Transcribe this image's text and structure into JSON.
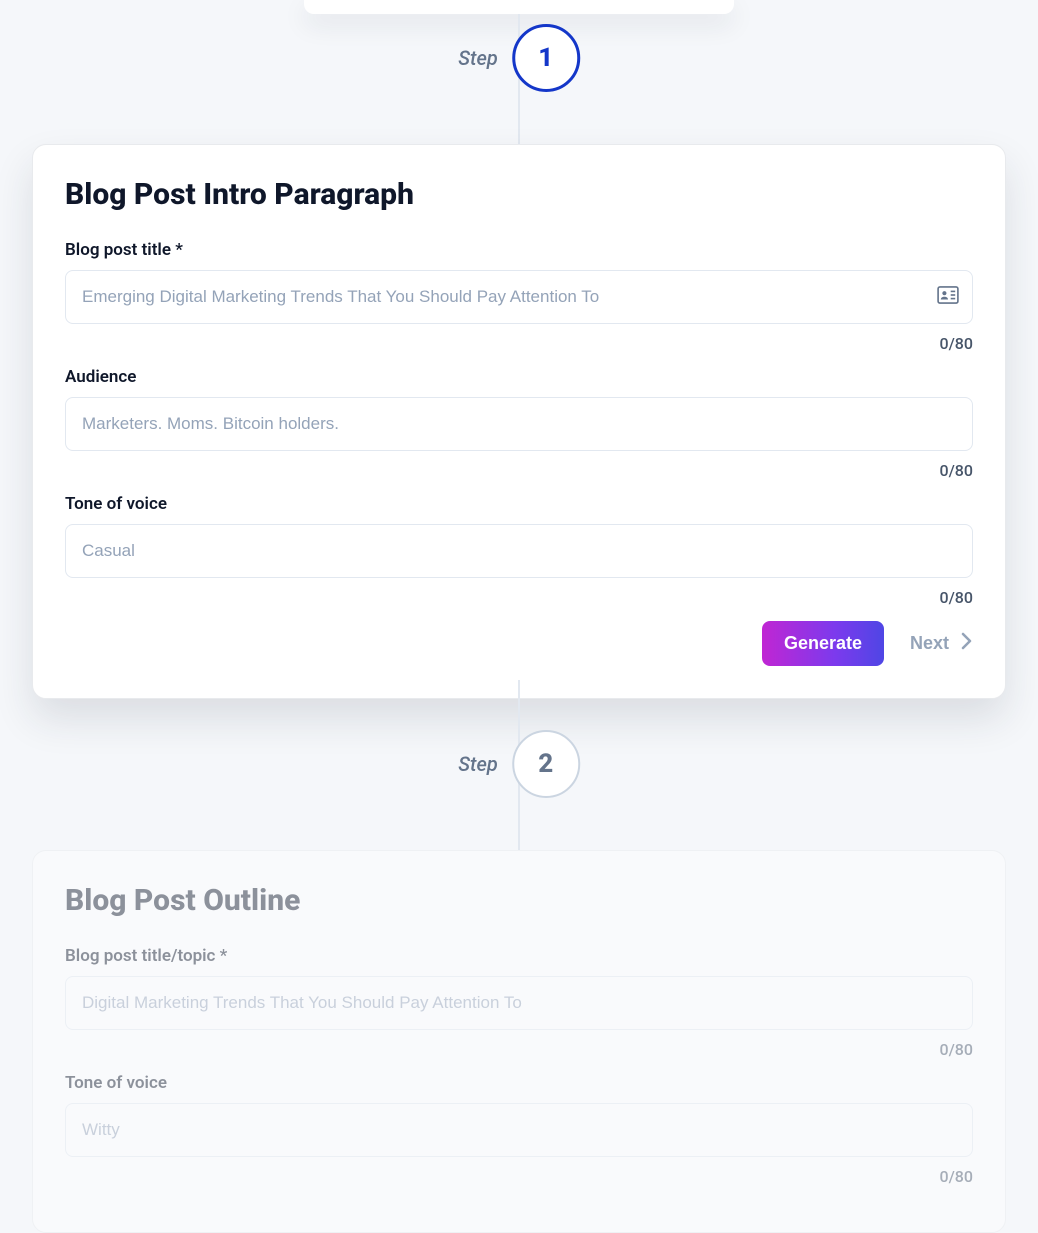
{
  "stepper": {
    "step_label": "Step",
    "step1_number": "1",
    "step2_number": "2"
  },
  "card1": {
    "title": "Blog Post Intro Paragraph",
    "fields": {
      "title": {
        "label": "Blog post title *",
        "placeholder": "Emerging Digital Marketing Trends That You Should Pay Attention To",
        "counter": "0/80"
      },
      "audience": {
        "label": "Audience",
        "placeholder": "Marketers. Moms. Bitcoin holders.",
        "counter": "0/80"
      },
      "tone": {
        "label": "Tone of voice",
        "placeholder": "Casual",
        "counter": "0/80"
      }
    },
    "actions": {
      "generate": "Generate",
      "next": "Next"
    }
  },
  "card2": {
    "title": "Blog Post Outline",
    "fields": {
      "title": {
        "label": "Blog post title/topic *",
        "placeholder": "Digital Marketing Trends That You Should Pay Attention To",
        "counter": "0/80"
      },
      "tone": {
        "label": "Tone of voice",
        "placeholder": "Witty",
        "counter": "0/80"
      }
    }
  }
}
